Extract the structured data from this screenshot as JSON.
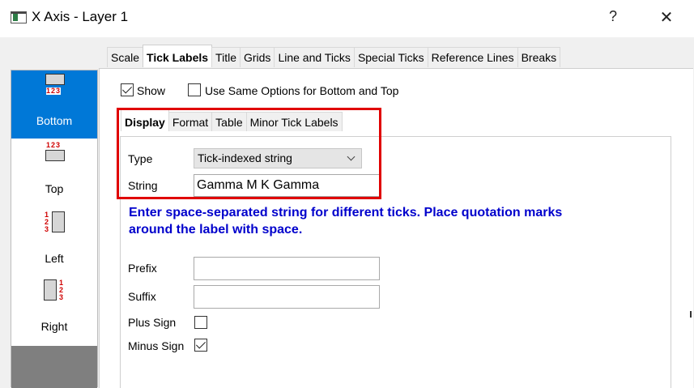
{
  "window": {
    "title": "X Axis - Layer 1",
    "help_label": "?",
    "close_label": "✕"
  },
  "outer_tabs": [
    "Scale",
    "Tick Labels",
    "Title",
    "Grids",
    "Line and Ticks",
    "Special Ticks",
    "Reference Lines",
    "Breaks"
  ],
  "sidebar": {
    "items": [
      {
        "label": "Bottom",
        "nums": "123",
        "selected": true
      },
      {
        "label": "Top",
        "nums": "123"
      },
      {
        "label": "Left",
        "nums": "1 2 3"
      },
      {
        "label": "Right",
        "nums": "1 2 3"
      }
    ]
  },
  "options": {
    "show_label": "Show",
    "show_checked": true,
    "same_options_label": "Use Same Options for Bottom and Top",
    "same_options_checked": false
  },
  "inner_tabs": [
    "Display",
    "Format",
    "Table",
    "Minor Tick Labels"
  ],
  "display": {
    "type_label": "Type",
    "type_value": "Tick-indexed string",
    "string_label": "String",
    "string_value": "Gamma M K Gamma",
    "hint_line1": "Enter space-separated string for different ticks. Place quotation marks",
    "hint_line2": "around the label with space.",
    "prefix_label": "Prefix",
    "prefix_value": "",
    "suffix_label": "Suffix",
    "suffix_value": "",
    "plus_sign_label": "Plus Sign",
    "plus_sign_checked": false,
    "minus_sign_label": "Minus Sign",
    "minus_sign_checked": true
  },
  "colors": {
    "selection": "#0078d7",
    "highlight": "#e00000",
    "hint_text": "#0000cc"
  }
}
